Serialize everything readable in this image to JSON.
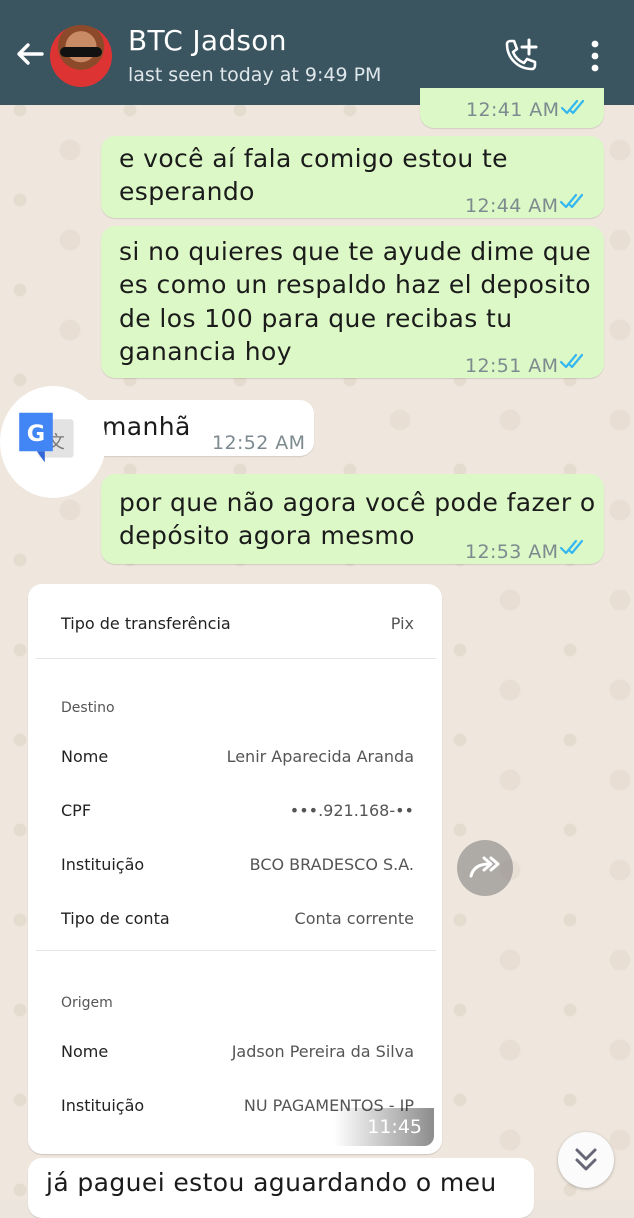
{
  "header": {
    "contact_name": "BTC Jadson",
    "last_seen": "last seen today at 9:49 PM",
    "icons": [
      "back-arrow-icon",
      "add-call-icon",
      "more-vert-icon"
    ]
  },
  "messages": [
    {
      "direction": "out",
      "text": "",
      "time": "12:41 AM",
      "status": "read"
    },
    {
      "direction": "out",
      "text_lines": [
        "e você aí fala comigo estou te",
        "esperando"
      ],
      "time": "12:44 AM",
      "status": "read"
    },
    {
      "direction": "out",
      "text_lines": [
        "si no quieres que te ayude dime que",
        "es como un respaldo haz el deposito",
        "de los 100 para que recibas tu",
        "ganancia hoy"
      ],
      "time": "12:51 AM",
      "status": "read"
    },
    {
      "direction": "in",
      "text": "manhã",
      "time": "12:52 AM"
    },
    {
      "direction": "out",
      "text_lines": [
        "por que não agora você pode fazer o",
        "depósito agora mesmo"
      ],
      "time": "12:53 AM",
      "status": "read"
    },
    {
      "direction": "in",
      "text": "já paguei estou aguardando o meu",
      "time": ""
    }
  ],
  "receipt": {
    "tipo_label": "Tipo de transferência",
    "tipo_value": "Pix",
    "destino_section": "Destino",
    "destino": [
      {
        "label": "Nome",
        "value": "Lenir Aparecida Aranda"
      },
      {
        "label": "CPF",
        "value": "•••.921.168-••"
      },
      {
        "label": "Instituição",
        "value": "BCO BRADESCO S.A."
      },
      {
        "label": "Tipo de conta",
        "value": "Conta corrente"
      }
    ],
    "origem_section": "Origem",
    "origem": [
      {
        "label": "Nome",
        "value": "Jadson Pereira da Silva"
      },
      {
        "label": "Instituição",
        "value": "NU PAGAMENTOS - IP"
      }
    ],
    "time": "11:45 AM"
  },
  "colors": {
    "header": "#3a5560",
    "outgoing_bubble": "#dcf8c6",
    "incoming_bubble": "#ffffff",
    "read_ticks": "#34b7f1",
    "chat_background": "#efe7de"
  }
}
